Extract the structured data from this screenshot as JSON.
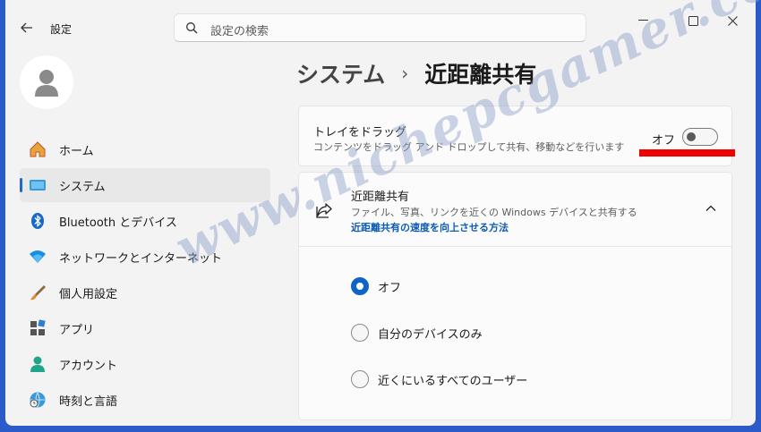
{
  "window": {
    "title": "設定",
    "search_placeholder": "設定の検索"
  },
  "sidebar": {
    "items": [
      {
        "label": "ホーム",
        "icon": "home-icon"
      },
      {
        "label": "システム",
        "icon": "monitor-icon",
        "active": true
      },
      {
        "label": "Bluetooth とデバイス",
        "icon": "bluetooth-icon"
      },
      {
        "label": "ネットワークとインターネット",
        "icon": "wifi-icon"
      },
      {
        "label": "個人用設定",
        "icon": "brush-icon"
      },
      {
        "label": "アプリ",
        "icon": "apps-icon"
      },
      {
        "label": "アカウント",
        "icon": "person-icon"
      },
      {
        "label": "時刻と言語",
        "icon": "globe-clock-icon"
      }
    ]
  },
  "breadcrumb": {
    "parent": "システム",
    "separator": "›",
    "current": "近距離共有"
  },
  "tray_card": {
    "title": "トレイをドラッグ",
    "description": "コンテンツをドラッグ アンド ドロップして共有、移動などを行います",
    "toggle_label": "オフ",
    "toggle_on": false
  },
  "nearby_card": {
    "title": "近距離共有",
    "description": "ファイル、写真、リンクを近くの Windows デバイスと共有する",
    "link": "近距離共有の速度を向上させる方法",
    "options": [
      {
        "label": "オフ",
        "checked": true
      },
      {
        "label": "自分のデバイスのみ",
        "checked": false
      },
      {
        "label": "近くにいるすべてのユーザー",
        "checked": false
      }
    ]
  },
  "watermark": "www.nichepcgamer.com",
  "colors": {
    "accent": "#0f64c6",
    "highlight": "#f00000"
  }
}
